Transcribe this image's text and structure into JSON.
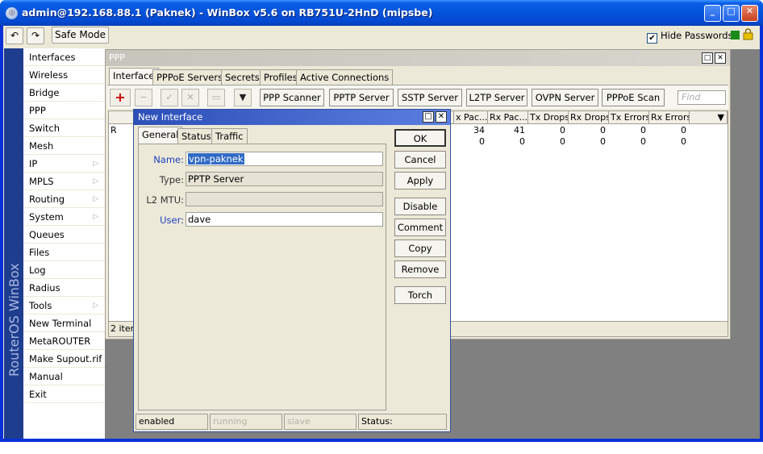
{
  "window": {
    "title": "admin@192.168.88.1 (Paknek) - WinBox v5.6 on RB751U-2HnD (mipsbe)",
    "minimize": "_",
    "maximize": "□",
    "close": "✕"
  },
  "toolbar": {
    "undo": "↶",
    "redo": "↷",
    "safe_mode": "Safe Mode",
    "hide_passwords_label": "Hide Passwords",
    "hide_passwords_checked": "✔"
  },
  "sidebar": {
    "vertical_label": "RouterOS WinBox",
    "items": [
      {
        "label": "Interfaces",
        "submenu": ""
      },
      {
        "label": "Wireless",
        "submenu": ""
      },
      {
        "label": "Bridge",
        "submenu": ""
      },
      {
        "label": "PPP",
        "submenu": ""
      },
      {
        "label": "Switch",
        "submenu": ""
      },
      {
        "label": "Mesh",
        "submenu": ""
      },
      {
        "label": "IP",
        "submenu": "▷"
      },
      {
        "label": "MPLS",
        "submenu": "▷"
      },
      {
        "label": "Routing",
        "submenu": "▷"
      },
      {
        "label": "System",
        "submenu": "▷"
      },
      {
        "label": "Queues",
        "submenu": ""
      },
      {
        "label": "Files",
        "submenu": ""
      },
      {
        "label": "Log",
        "submenu": ""
      },
      {
        "label": "Radius",
        "submenu": ""
      },
      {
        "label": "Tools",
        "submenu": "▷"
      },
      {
        "label": "New Terminal",
        "submenu": ""
      },
      {
        "label": "MetaROUTER",
        "submenu": ""
      },
      {
        "label": "Make Supout.rif",
        "submenu": ""
      },
      {
        "label": "Manual",
        "submenu": ""
      },
      {
        "label": "Exit",
        "submenu": ""
      }
    ]
  },
  "ppp": {
    "title": "PPP",
    "tabs": [
      "Interface",
      "PPPoE Servers",
      "Secrets",
      "Profiles",
      "Active Connections"
    ],
    "buttons": [
      "PPP Scanner",
      "PPTP Server",
      "SSTP Server",
      "L2TP Server",
      "OVPN Server",
      "PPPoE Scan"
    ],
    "find_placeholder": "Find",
    "icons": {
      "add": "+",
      "remove": "−",
      "enable": "✓",
      "disable": "✕",
      "comment": "▭",
      "filter": "▼"
    },
    "columns": [
      "x Pac...",
      "Rx Pac...",
      "Tx Drops",
      "Rx Drops",
      "Tx Errors",
      "Rx Errors"
    ],
    "rows": [
      {
        "flag": "R",
        "values": [
          "34",
          "41",
          "0",
          "0",
          "0",
          "0"
        ]
      },
      {
        "flag": "",
        "values": [
          "0",
          "0",
          "0",
          "0",
          "0",
          "0"
        ]
      }
    ],
    "items_count": "2 item"
  },
  "dialog": {
    "title": "New Interface",
    "tabs": [
      "General",
      "Status",
      "Traffic"
    ],
    "fields": {
      "name_label": "Name:",
      "name_value": "vpn-paknek",
      "type_label": "Type:",
      "type_value": "PPTP Server",
      "l2mtu_label": "L2 MTU:",
      "l2mtu_value": "",
      "user_label": "User:",
      "user_value": "dave"
    },
    "buttons": [
      "OK",
      "Cancel",
      "Apply",
      "Disable",
      "Comment",
      "Copy",
      "Remove",
      "Torch"
    ],
    "status": {
      "enabled": "enabled",
      "running": "running",
      "slave": "slave",
      "status": "Status:"
    }
  },
  "colors": {
    "xp_blue": "#0553db",
    "sidebar_strip": "#1e3d8e",
    "dialog_title": "#2c4fb8",
    "label_blue": "#1d3fbd"
  }
}
